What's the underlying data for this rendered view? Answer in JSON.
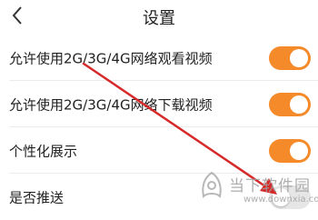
{
  "header": {
    "back_icon": "chevron-left-icon",
    "title": "设置"
  },
  "settings": [
    {
      "label": "允许使用2G/3G/4G网络观看视频",
      "enabled": true
    },
    {
      "label": "允许使用2G/3G/4G网络下载视频",
      "enabled": true
    },
    {
      "label": "个性化展示",
      "enabled": true
    },
    {
      "label": "是否推送",
      "enabled": false
    }
  ],
  "colors": {
    "toggle_on": "#f48a2a",
    "toggle_off": "#e6e6e6",
    "annotation_arrow": "#d62a2a"
  },
  "watermark": {
    "title": "当下软件园",
    "url": "www.downxia.com"
  }
}
